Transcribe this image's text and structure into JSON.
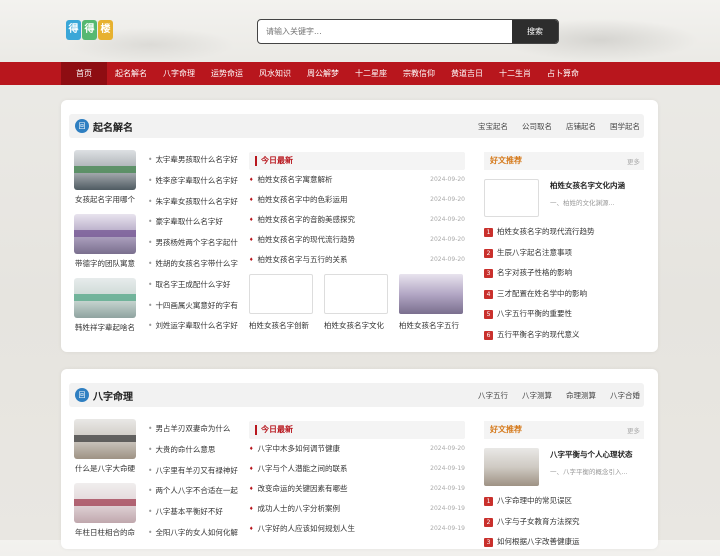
{
  "logo": {
    "chars": [
      "得",
      "得",
      "楼"
    ],
    "colors": [
      "#3aa7d8",
      "#56b871",
      "#e7b12f"
    ]
  },
  "search": {
    "placeholder": "请输入关键字...",
    "button": "搜索"
  },
  "nav": [
    "首页",
    "起名解名",
    "八字命理",
    "运势命运",
    "风水知识",
    "周公解梦",
    "十二星座",
    "宗教信仰",
    "黄道吉日",
    "十二生肖",
    "占卜算命"
  ],
  "section1": {
    "icon": "回",
    "title": "起名解名",
    "links": [
      "宝宝起名",
      "公司取名",
      "店铺起名",
      "国学起名"
    ],
    "thumbs": [
      "女孩起名字用哪个",
      "带德字的团队寓意",
      "韩姓祥字辈起啥名"
    ],
    "list": [
      "太宇辈男孩取什么名字好",
      "姓李彦字辈取什么名字好",
      "朱字辈女孩取什么名字好",
      "豪字辈取什么名字好",
      "男孩杨姓两个字名字起什",
      "姓胡的女孩名字带什么字",
      "取名字王成配什么字好",
      "十四画属火寓意好的字有",
      "刘姓运字辈取什么名字好"
    ],
    "today": "今日最新",
    "news": [
      {
        "t": "柏姓女孩名字寓意解析",
        "d": "2024-09-20"
      },
      {
        "t": "柏姓女孩名字中的色彩运用",
        "d": "2024-09-20"
      },
      {
        "t": "柏姓女孩名字的音韵美感探究",
        "d": "2024-09-20"
      },
      {
        "t": "柏姓女孩名字的现代流行趋势",
        "d": "2024-09-20"
      },
      {
        "t": "柏姓女孩名字与五行的关系",
        "d": "2024-09-20"
      }
    ],
    "pics": [
      "柏姓女孩名字创新",
      "柏姓女孩名字文化",
      "柏姓女孩名字五行"
    ],
    "hot": "好文推荐",
    "more": "更多",
    "feat": {
      "title": "柏姓女孩名字文化内涵",
      "desc": "一、柏姓的文化渊源..."
    },
    "rank": [
      "柏姓女孩名字的现代流行趋势",
      "生辰八字起名注意事项",
      "名字对孩子性格的影响",
      "三才配置在姓名学中的影响",
      "八字五行平衡的重要性",
      "五行平衡名字的现代意义"
    ]
  },
  "section2": {
    "icon": "回",
    "title": "八字命理",
    "links": [
      "八字五行",
      "八字测算",
      "命理测算",
      "八字合婚"
    ],
    "thumbs": [
      "什么是八字大命硬",
      "年柱日柱相合的命"
    ],
    "thumb_band_text": [
      "什么是八字大命硬",
      "年柱日柱相合的命"
    ],
    "list": [
      "男占羊刃双妻命为什么",
      "大贵的命什么意思",
      "八字里有羊刃又有禄神好",
      "两个人八字不合适在一起",
      "八字基本平衡好不好",
      "全阳八字的女人如何化解"
    ],
    "today": "今日最新",
    "news": [
      {
        "t": "八字中木多如何调节健康",
        "d": "2024-09-20"
      },
      {
        "t": "八字与个人潜能之间的联系",
        "d": "2024-09-19"
      },
      {
        "t": "改变命运的关键因素有哪些",
        "d": "2024-09-19"
      },
      {
        "t": "成功人士的八字分析案例",
        "d": "2024-09-19"
      },
      {
        "t": "八字好的人应该如何规划人生",
        "d": "2024-09-19"
      }
    ],
    "hot": "好文推荐",
    "more": "更多",
    "feat": {
      "title": "八字平衡与个人心理状态",
      "desc": "一、八字平衡的概念引入..."
    },
    "rank": [
      "八字命理中的常见误区",
      "八字与子女教育方法探究",
      "如何根据八字改善健康运"
    ]
  }
}
